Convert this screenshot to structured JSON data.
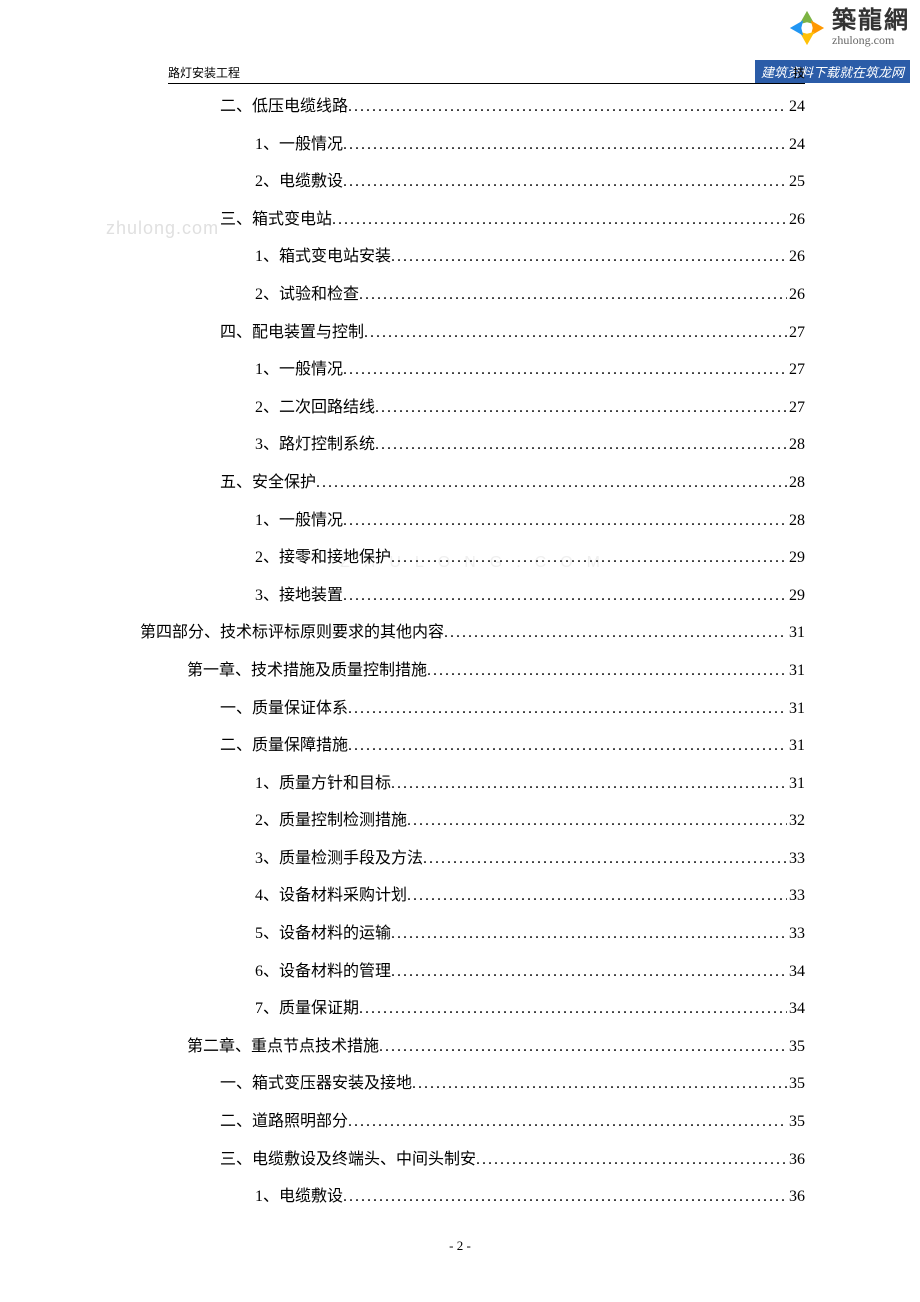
{
  "logo": {
    "cn": "築龍網",
    "en": "zhulong.com"
  },
  "banner": "建筑资料下载就在筑龙网",
  "header": {
    "left": "路灯安装工程",
    "right": "技"
  },
  "watermark": "zhulong.com",
  "watermark2": "ZHULONG.COM",
  "toc": [
    {
      "indent": 2,
      "label": "二、低压电缆线路",
      "page": "24"
    },
    {
      "indent": 3,
      "label": "1、一般情况",
      "page": "24"
    },
    {
      "indent": 3,
      "label": "2、电缆敷设",
      "page": "25"
    },
    {
      "indent": 2,
      "label": "三、箱式变电站",
      "page": "26"
    },
    {
      "indent": 3,
      "label": "1、箱式变电站安装",
      "page": "26"
    },
    {
      "indent": 3,
      "label": "2、试验和检查",
      "page": "26"
    },
    {
      "indent": 2,
      "label": "四、配电装置与控制",
      "page": "27"
    },
    {
      "indent": 3,
      "label": "1、一般情况",
      "page": "27"
    },
    {
      "indent": 3,
      "label": "2、二次回路结线",
      "page": "27"
    },
    {
      "indent": 3,
      "label": "3、路灯控制系统",
      "page": "28"
    },
    {
      "indent": 2,
      "label": "五、安全保护",
      "page": "28"
    },
    {
      "indent": 3,
      "label": "1、一般情况",
      "page": "28"
    },
    {
      "indent": 3,
      "label": "2、接零和接地保护",
      "page": "29"
    },
    {
      "indent": 3,
      "label": "3、接地装置",
      "page": "29"
    },
    {
      "indent": 0,
      "label": "第四部分、技术标评标原则要求的其他内容",
      "page": "31"
    },
    {
      "indent": 1,
      "label": "第一章、技术措施及质量控制措施",
      "page": "31"
    },
    {
      "indent": 2,
      "label": "一、质量保证体系",
      "page": "31"
    },
    {
      "indent": 2,
      "label": "二、质量保障措施",
      "page": "31"
    },
    {
      "indent": 3,
      "label": "1、质量方针和目标",
      "page": "31"
    },
    {
      "indent": 3,
      "label": "2、质量控制检测措施",
      "page": "32"
    },
    {
      "indent": 3,
      "label": "3、质量检测手段及方法",
      "page": "33"
    },
    {
      "indent": 3,
      "label": "4、设备材料采购计划",
      "page": "33"
    },
    {
      "indent": 3,
      "label": "5、设备材料的运输",
      "page": "33"
    },
    {
      "indent": 3,
      "label": "6、设备材料的管理",
      "page": "34"
    },
    {
      "indent": 3,
      "label": "7、质量保证期",
      "page": "34"
    },
    {
      "indent": 1,
      "label": "第二章、重点节点技术措施",
      "page": "35"
    },
    {
      "indent": 2,
      "label": "一、箱式变压器安装及接地",
      "page": "35"
    },
    {
      "indent": 2,
      "label": "二、道路照明部分",
      "page": "35"
    },
    {
      "indent": 2,
      "label": "三、电缆敷设及终端头、中间头制安",
      "page": "36"
    },
    {
      "indent": 3,
      "label": "1、电缆敷设",
      "page": "36"
    }
  ],
  "pageNumber": "- 2 -"
}
